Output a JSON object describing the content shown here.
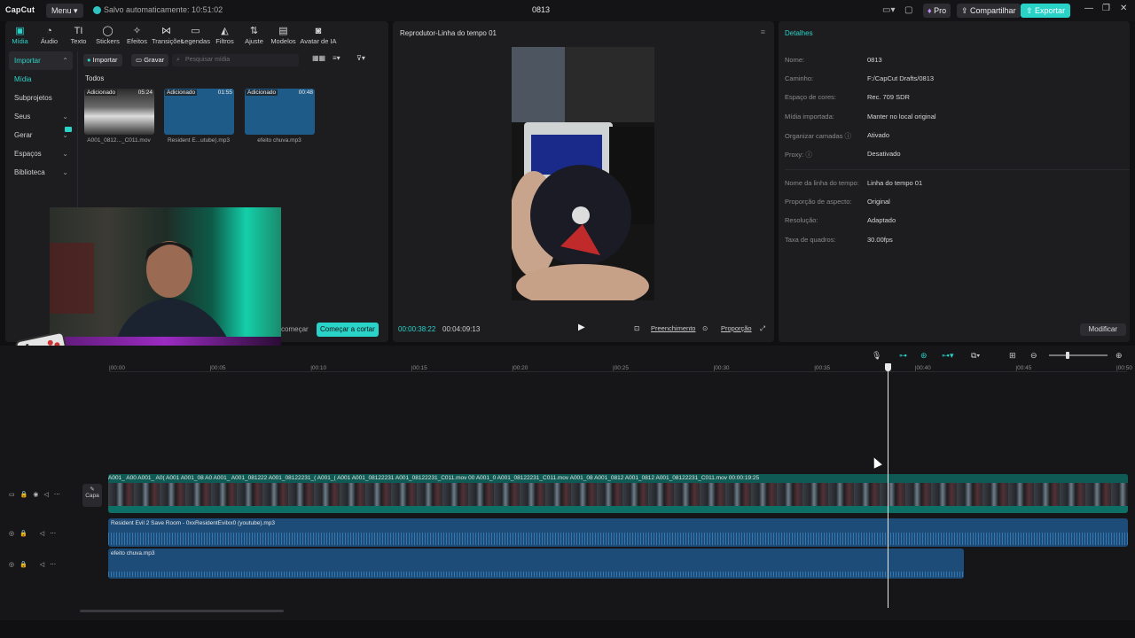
{
  "titlebar": {
    "logo": "CapCut",
    "menu": "Menu ▾",
    "autosave": "Salvo automaticamente: 10:51:02",
    "project": "0813",
    "pro": "Pro",
    "share": "Compartilhar",
    "export": "Exportar"
  },
  "toolbar": {
    "tabs": [
      {
        "label": "Mídia",
        "icon": "media-icon"
      },
      {
        "label": "Áudio",
        "icon": "audio-icon"
      },
      {
        "label": "Texto",
        "icon": "text-icon"
      },
      {
        "label": "Stickers",
        "icon": "sticker-icon"
      },
      {
        "label": "Efeitos",
        "icon": "effects-icon"
      },
      {
        "label": "Transições",
        "icon": "transitions-icon"
      },
      {
        "label": "Legendas",
        "icon": "captions-icon"
      },
      {
        "label": "Filtros",
        "icon": "filters-icon"
      },
      {
        "label": "Ajuste",
        "icon": "adjust-icon"
      },
      {
        "label": "Modelos",
        "icon": "templates-icon"
      },
      {
        "label": "Avatar de IA",
        "icon": "ai-avatar-icon"
      }
    ]
  },
  "sidebar": {
    "items": [
      {
        "label": "Importar"
      },
      {
        "label": "Mídia"
      },
      {
        "label": "Subprojetos"
      },
      {
        "label": "Seus"
      },
      {
        "label": "Gerar"
      },
      {
        "label": "Espaços"
      },
      {
        "label": "Biblioteca"
      }
    ]
  },
  "media": {
    "import_btn": "Importar",
    "record_btn": "Gravar",
    "search_placeholder": "Pesquisar mídia",
    "all_label": "Todos",
    "items": [
      {
        "tag": "Adicionado",
        "duration": "05:24",
        "name": "A001_0812..._C011.mov"
      },
      {
        "tag": "Adicionado",
        "duration": "01:55",
        "name": "Resident E...utube).mp3"
      },
      {
        "tag": "Adicionado",
        "duration": "00:48",
        "name": "efeito chuva.mp3"
      }
    ],
    "begin_text": "começar",
    "start_cut_btn": "Começar a cortar"
  },
  "player": {
    "title": "Reprodutor-Linha do tempo 01",
    "current_time": "00:00:38:22",
    "total_time": "00:04:09:13",
    "fill": "Preenchimento",
    "ratio": "Proporção"
  },
  "details": {
    "title": "Detalhes",
    "rows": [
      {
        "k": "Nome:",
        "v": "0813"
      },
      {
        "k": "Caminho:",
        "v": "F:/CapCut Drafts/0813"
      },
      {
        "k": "Espaço de cores:",
        "v": "Rec. 709 SDR"
      },
      {
        "k": "Mídia importada:",
        "v": "Manter no local original"
      },
      {
        "k": "Organizar camadas ⓘ",
        "v": "Ativado"
      },
      {
        "k": "Proxy: ⓘ",
        "v": "Desativado"
      },
      {
        "k": "Nome da linha do tempo:",
        "v": "Linha do tempo 01"
      },
      {
        "k": "Proporção de aspecto:",
        "v": "Original"
      },
      {
        "k": "Resolução:",
        "v": "Adaptado"
      },
      {
        "k": "Taxa de quadros:",
        "v": "30.00fps"
      }
    ],
    "modify_btn": "Modificar"
  },
  "timeline": {
    "ruler": [
      "00:00",
      "00:05",
      "00:10",
      "00:15",
      "00:20",
      "00:25",
      "00:30",
      "00:35",
      "00:40",
      "00:45",
      "00:50"
    ],
    "cover_label": "Capa",
    "video_labels": "A001_  A00  A001_  A0(  A001  A001_08  A0  A001_  A001_081222  A001_08122231_(  A001_(  A001  A001_08122231  A001_08122231_C011.mov  00  A001_0  A001_08122231_C011.mov  A001_08  A001_0812  A001_0812  A001_08122231_C011.mov 00:00:19:25",
    "audio_track_1": "Resident Evil 2 Save Room - 0xxResidentEvilxx0 (youtube).mp3",
    "audio_track_2": "efeito chuva.mp3"
  },
  "colors": {
    "accent": "#2ad3c8",
    "panel": "#1d1d20",
    "video_clip": "#0e6f66",
    "audio_clip": "#1e4c78"
  }
}
